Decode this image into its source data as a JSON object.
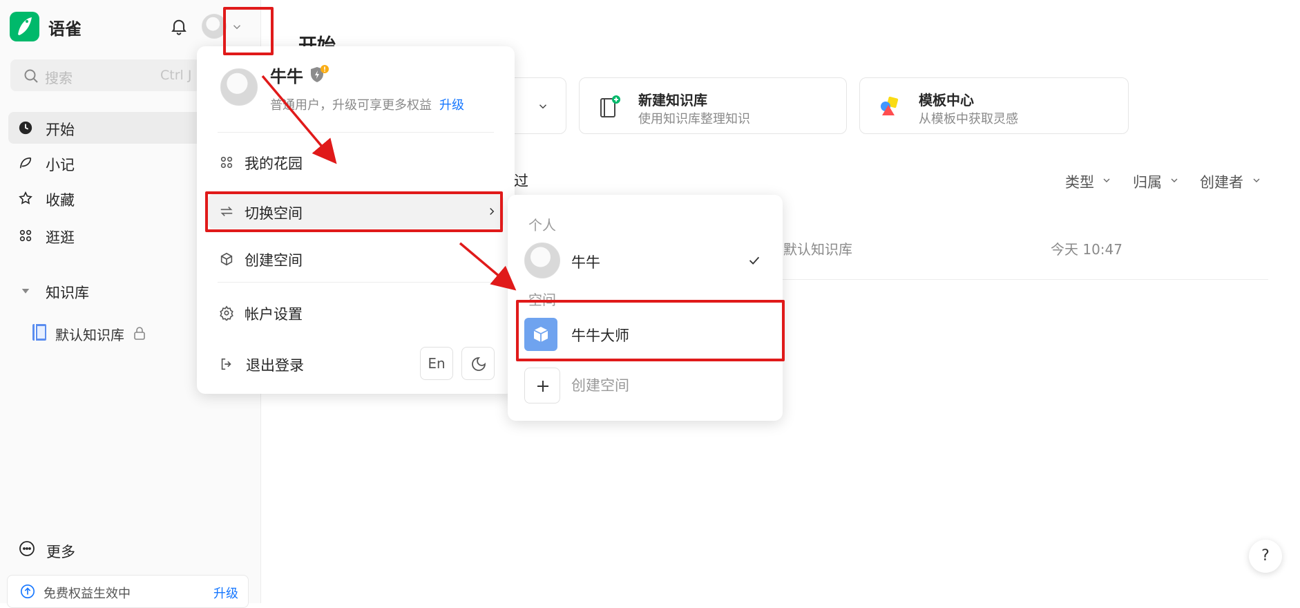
{
  "app": {
    "brand": "语雀"
  },
  "search": {
    "placeholder": "搜索",
    "shortcut": "Ctrl J"
  },
  "sidebar": {
    "items": [
      {
        "label": "开始",
        "icon": "clock-icon",
        "active": true
      },
      {
        "label": "小记",
        "icon": "feather-icon"
      },
      {
        "label": "收藏",
        "icon": "star-icon"
      },
      {
        "label": "逛逛",
        "icon": "grid-icon"
      }
    ],
    "library_section": "知识库",
    "library_item": "默认知识库",
    "more_label": "更多",
    "benefit_text": "免费权益生效中",
    "benefit_upgrade": "升级"
  },
  "main": {
    "title": "开始",
    "cards": [
      {
        "title": "新建知识库",
        "subtitle": "使用知识库整理知识"
      },
      {
        "title": "模板中心",
        "subtitle": "从模板中获取灵感"
      }
    ],
    "partial_heading": "过",
    "filters": [
      "类型",
      "归属",
      "创建者"
    ],
    "row": {
      "library": "默认知识库",
      "time": "今天 10:47"
    }
  },
  "user_menu": {
    "name": "牛牛",
    "desc": "普通用户，升级可享更多权益",
    "upgrade": "升级",
    "items": {
      "garden": "我的花园",
      "switch_space": "切换空间",
      "create_space": "创建空间",
      "account_settings": "帐户设置",
      "logout": "退出登录"
    },
    "lang_btn": "En"
  },
  "space_menu": {
    "personal_section": "个人",
    "personal_name": "牛牛",
    "space_section": "空间",
    "space_name": "牛牛大师",
    "create_space": "创建空间"
  },
  "help": "?",
  "colors": {
    "brand": "#00b96b",
    "link": "#1677ff",
    "annotation": "#e01a1a"
  }
}
